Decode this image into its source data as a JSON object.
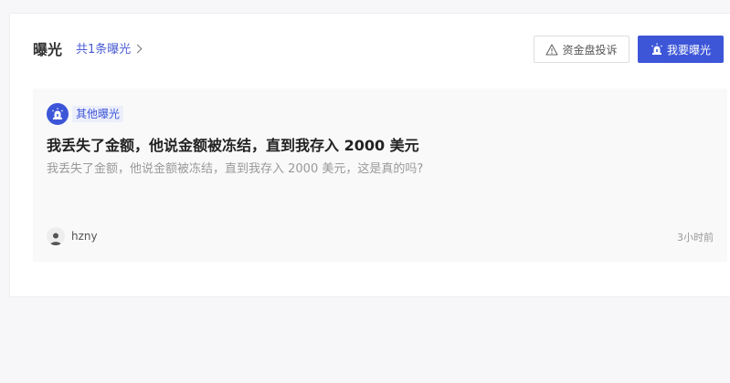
{
  "header": {
    "title": "曝光",
    "count_link": "共1条曝光",
    "complain_button": "资金盘投诉",
    "expose_button": "我要曝光"
  },
  "post": {
    "category": "其他曝光",
    "title": "我丢失了金额，他说金额被冻结，直到我存入 2000 美元",
    "description": "我丢失了金额，他说金额被冻结，直到我存入 2000 美元，这是真的吗?",
    "author": "hzny",
    "time": "3小时前"
  },
  "colors": {
    "accent": "#3d56d8",
    "page_bg": "#f7f7f9",
    "post_bg": "#f9f9fa"
  },
  "icons": {
    "complain": "warning-triangle-icon",
    "expose": "alarm-siren-icon",
    "category": "alarm-siren-icon",
    "avatar": "user-silhouette-icon",
    "count_link": "chevron-right-icon"
  }
}
